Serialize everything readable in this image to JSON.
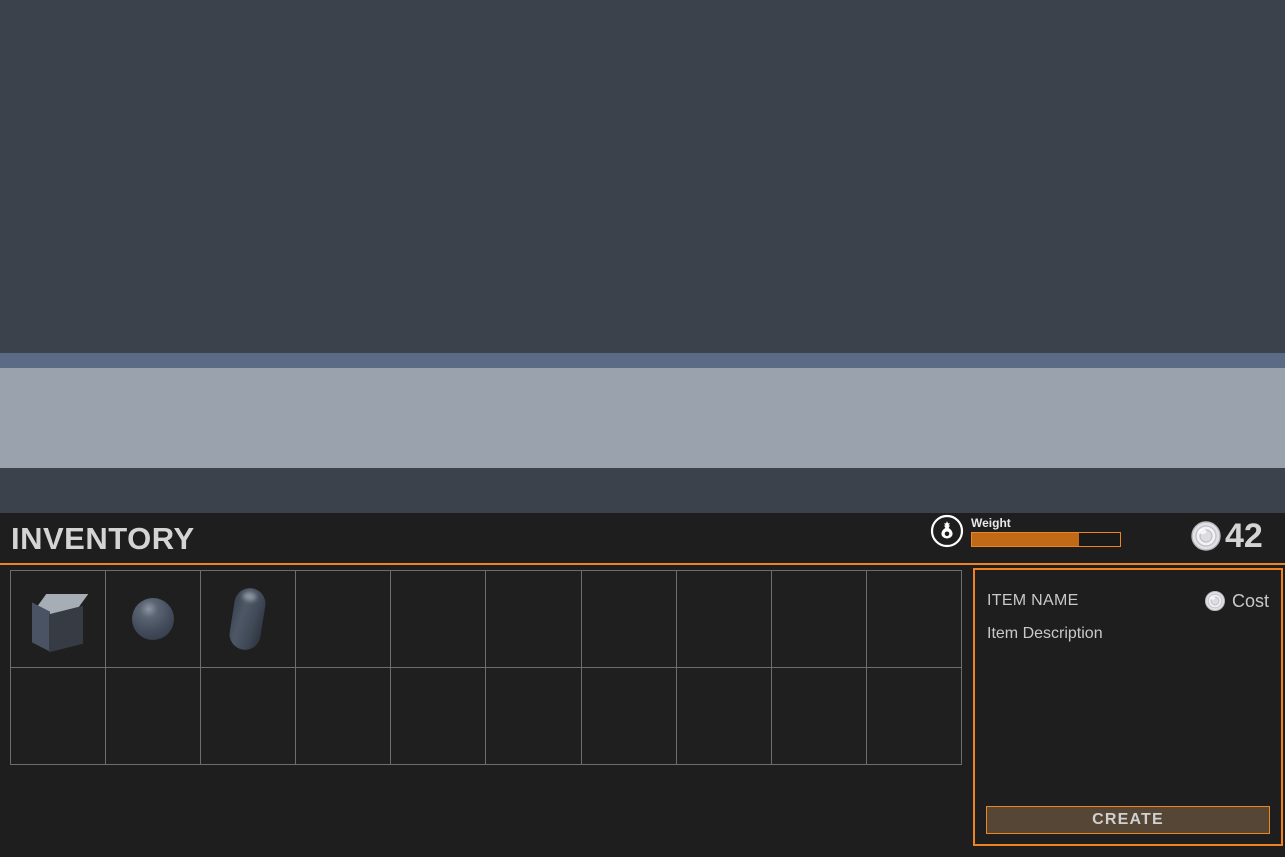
{
  "viewport": {
    "sky_color": "#3c424c",
    "horizon_color": "#5c6b85",
    "ground_color": "#9aa3ad",
    "floor_color": "#3c424c"
  },
  "header": {
    "title": "INVENTORY",
    "accent_color": "#ef8321",
    "weight": {
      "label": "Weight",
      "icon": "money-bag-icon",
      "fill_percent": 72,
      "fill_color": "#c06a18"
    },
    "currency": {
      "icon": "coin-icon",
      "amount": "42"
    }
  },
  "grid": {
    "columns": 10,
    "rows": 2,
    "slots": [
      {
        "index": 0,
        "shape": "cube",
        "occupied": true
      },
      {
        "index": 1,
        "shape": "sphere",
        "occupied": true
      },
      {
        "index": 2,
        "shape": "capsule",
        "occupied": true
      },
      {
        "index": 3,
        "shape": null,
        "occupied": false
      },
      {
        "index": 4,
        "shape": null,
        "occupied": false
      },
      {
        "index": 5,
        "shape": null,
        "occupied": false
      },
      {
        "index": 6,
        "shape": null,
        "occupied": false
      },
      {
        "index": 7,
        "shape": null,
        "occupied": false
      },
      {
        "index": 8,
        "shape": null,
        "occupied": false
      },
      {
        "index": 9,
        "shape": null,
        "occupied": false
      },
      {
        "index": 10,
        "shape": null,
        "occupied": false
      },
      {
        "index": 11,
        "shape": null,
        "occupied": false
      },
      {
        "index": 12,
        "shape": null,
        "occupied": false
      },
      {
        "index": 13,
        "shape": null,
        "occupied": false
      },
      {
        "index": 14,
        "shape": null,
        "occupied": false
      },
      {
        "index": 15,
        "shape": null,
        "occupied": false
      },
      {
        "index": 16,
        "shape": null,
        "occupied": false
      },
      {
        "index": 17,
        "shape": null,
        "occupied": false
      },
      {
        "index": 18,
        "shape": null,
        "occupied": false
      },
      {
        "index": 19,
        "shape": null,
        "occupied": false
      }
    ]
  },
  "detail_panel": {
    "item_name": "ITEM NAME",
    "cost_icon": "coin-icon",
    "cost_label": "Cost",
    "description": "Item Description",
    "create_label": "CREATE",
    "border_color": "#ef8321"
  }
}
